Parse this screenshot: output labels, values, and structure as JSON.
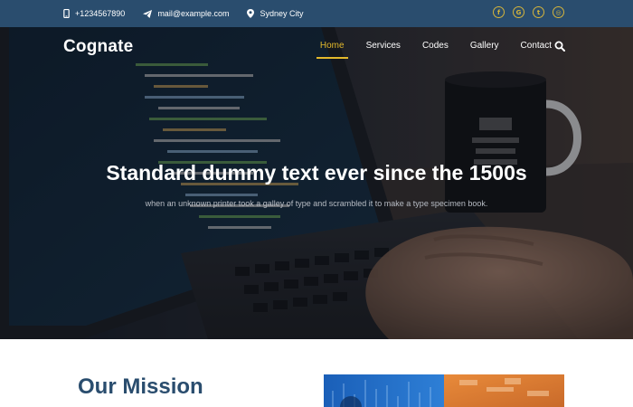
{
  "topbar": {
    "phone": "+1234567890",
    "email": "mail@example.com",
    "location": "Sydney City",
    "socials": [
      {
        "icon": "facebook-icon",
        "glyph": "f"
      },
      {
        "icon": "google-plus-icon",
        "glyph": "G"
      },
      {
        "icon": "twitter-icon",
        "glyph": "t"
      },
      {
        "icon": "dribbble-icon",
        "glyph": "◎"
      }
    ]
  },
  "colors": {
    "topbar_bg": "#2a4d6e",
    "accent": "#e3b92c",
    "heading": "#2a4d6e"
  },
  "navbar": {
    "logo": "Cognate",
    "menu": [
      {
        "label": "Home",
        "active": true
      },
      {
        "label": "Services"
      },
      {
        "label": "Codes"
      },
      {
        "label": "Gallery"
      },
      {
        "label": "Contact"
      }
    ]
  },
  "hero": {
    "title": "Standard dummy text ever since the 1500s",
    "subtitle": "when an unknown printer took a galley of type and scrambled it to make a type specimen book."
  },
  "mission": {
    "title": "Our Mission"
  }
}
